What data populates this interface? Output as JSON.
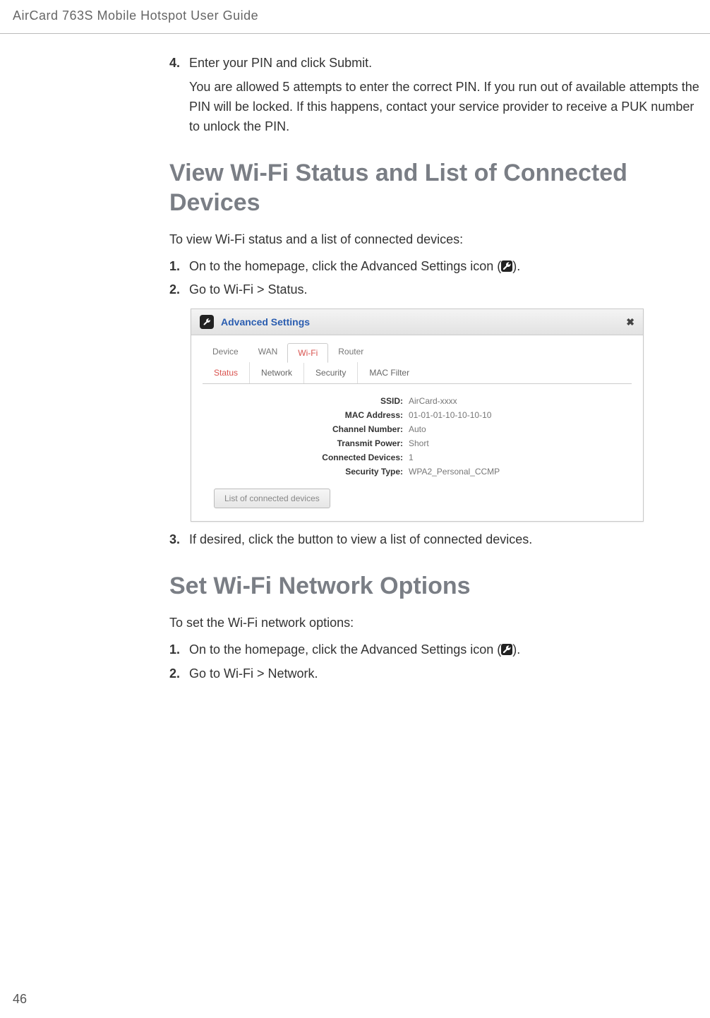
{
  "running_header": "AirCard 763S Mobile Hotspot User Guide",
  "page_number": "46",
  "intro_list": {
    "item4_num": "4.",
    "item4_line1": "Enter your PIN and click Submit.",
    "item4_sub": "You are allowed 5 attempts to enter the correct PIN. If you run out of available attempts the PIN will be locked. If this happens, contact your service provider to receive a PUK number to unlock the PIN."
  },
  "section1": {
    "title": "View Wi-Fi Status and List of Connected Devices",
    "lead": "To view Wi-Fi status and a list of connected devices:",
    "step1_num": "1.",
    "step1_pre": "On to the homepage, click the Advanced Settings icon (",
    "step1_post": ").",
    "step2_num": "2.",
    "step2": "Go to Wi-Fi > Status.",
    "step3_num": "3.",
    "step3": "If desired, click the button to view a list of connected devices."
  },
  "screenshot": {
    "title": "Advanced Settings",
    "close": "✖",
    "tabs1": [
      "Device",
      "WAN",
      "Wi-Fi",
      "Router"
    ],
    "tabs1_active_index": 2,
    "tabs2": [
      "Status",
      "Network",
      "Security",
      "MAC Filter"
    ],
    "tabs2_active_index": 0,
    "fields": [
      {
        "label": "SSID:",
        "value": "AirCard-xxxx"
      },
      {
        "label": "MAC Address:",
        "value": "01-01-01-10-10-10-10"
      },
      {
        "label": "Channel Number:",
        "value": "Auto"
      },
      {
        "label": "Transmit Power:",
        "value": "Short"
      },
      {
        "label": "Connected Devices:",
        "value": "1"
      },
      {
        "label": "Security Type:",
        "value": "WPA2_Personal_CCMP"
      }
    ],
    "button": "List of connected devices"
  },
  "section2": {
    "title": "Set Wi-Fi Network Options",
    "lead": "To set the Wi-Fi network options:",
    "step1_num": "1.",
    "step1_pre": "On to the homepage, click the Advanced Settings icon (",
    "step1_post": ").",
    "step2_num": "2.",
    "step2": "Go to Wi-Fi > Network."
  }
}
